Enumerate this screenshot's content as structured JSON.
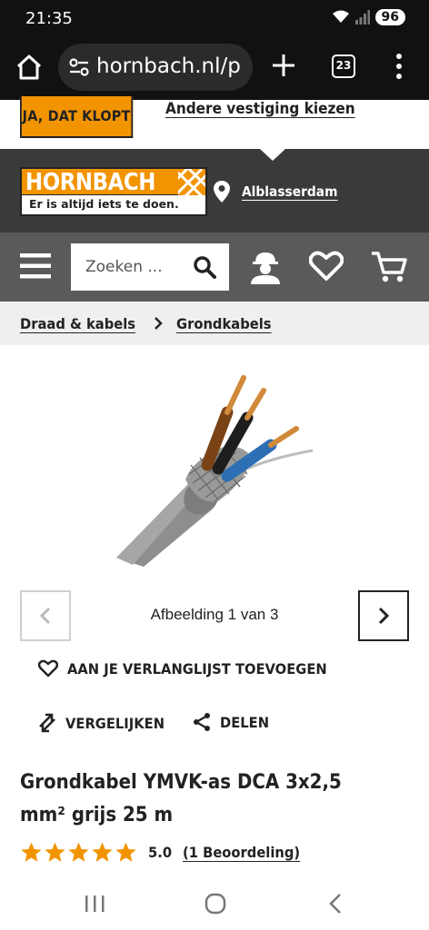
{
  "status": {
    "time": "21:35",
    "battery": "96"
  },
  "browser": {
    "url": "hornbach.nl/p",
    "tab_count": "23"
  },
  "store_confirm": {
    "confirm_label": "JA, DAT KLOPT",
    "other_store_label": "Andere vestiging kiezen"
  },
  "header": {
    "logo_word": "HORNBACH",
    "logo_slogan": "Er is altijd iets te doen.",
    "location": "Alblasserdam"
  },
  "search": {
    "placeholder": "Zoeken ..."
  },
  "breadcrumb": [
    "Draad & kabels",
    "Grondkabels"
  ],
  "gallery": {
    "counter": "Afbeelding 1 van 3"
  },
  "actions": {
    "wishlist": "AAN JE VERLANGLIJST TOEVOEGEN",
    "compare": "VERGELIJKEN",
    "share": "DELEN"
  },
  "product": {
    "title": "Grondkabel YMVK-as DCA 3x2,5 mm² grijs 25 m",
    "rating_stars": 5,
    "rating_value": "5.0",
    "rating_link": "(1 Beoordeling)"
  },
  "colors": {
    "brand_orange": "#f29400",
    "header_dark": "#3a3a3a",
    "nav_grey": "#5a5a5a",
    "star": "#f29400"
  },
  "icons": {
    "home": "home-icon",
    "url_tune": "tune-icon",
    "new_tab": "plus-icon",
    "tabs": "tabs-icon",
    "menu": "kebab-menu-icon",
    "location": "location-pin-icon",
    "hamburger": "hamburger-menu-icon",
    "search": "search-icon",
    "account": "worker-account-icon",
    "wishlist": "heart-icon",
    "cart": "cart-icon",
    "compare": "compare-arrows-icon",
    "share": "share-icon"
  }
}
